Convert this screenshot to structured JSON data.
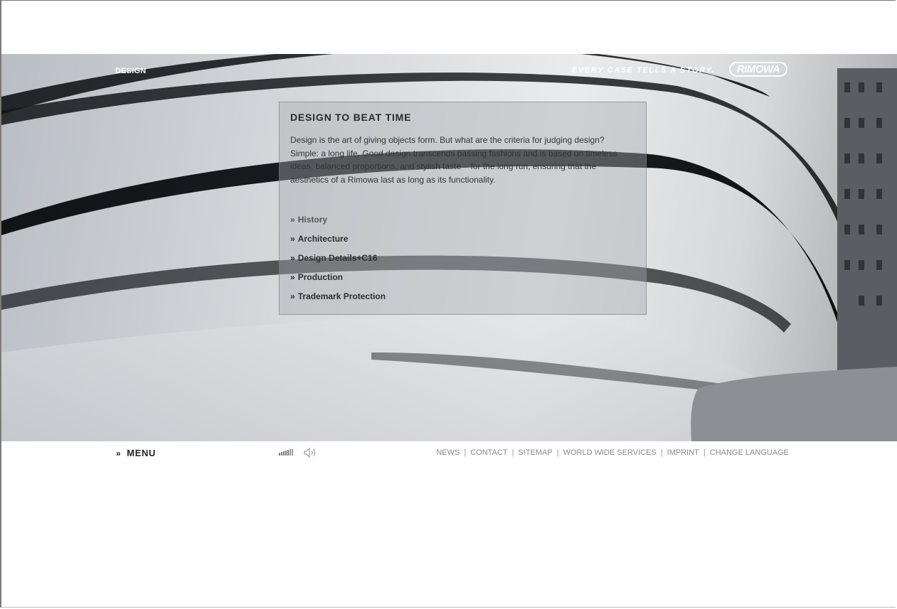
{
  "header": {
    "section_label": "DESIGN",
    "tagline": "EVERY CASE TELLS A STORY.",
    "logo_text": "RIMOWA"
  },
  "panel": {
    "title": "DESIGN TO BEAT TIME",
    "body": "Design is the art of giving objects form. But what are the criteria for judging design? Simple: a long life. Good design transcends passing fashions and is based on timeless ideas, balanced proportions, and stylish taste – for the long run, ensuring that the aesthetics of a Rimowa last as long as its functionality.",
    "link_prefix": "»",
    "links": [
      {
        "label": "History",
        "active": true
      },
      {
        "label": "Architecture",
        "active": false
      },
      {
        "label": "Design Details+C16",
        "active": false
      },
      {
        "label": "Production",
        "active": false
      },
      {
        "label": "Trademark Protection",
        "active": false
      }
    ]
  },
  "footer": {
    "menu_prefix": "»",
    "menu_label": "MENU",
    "volume_level_fraction": 0.6,
    "speaker_icon": "speaker-icon",
    "nav": [
      "NEWS",
      "CONTACT",
      "SITEMAP",
      "WORLD WIDE SERVICES",
      "IMPRINT",
      "CHANGE LANGUAGE"
    ],
    "nav_separator": "|"
  },
  "colors": {
    "text_dark": "#2a2a2a",
    "footer_link": "#8a8a8a",
    "white": "#ffffff"
  }
}
